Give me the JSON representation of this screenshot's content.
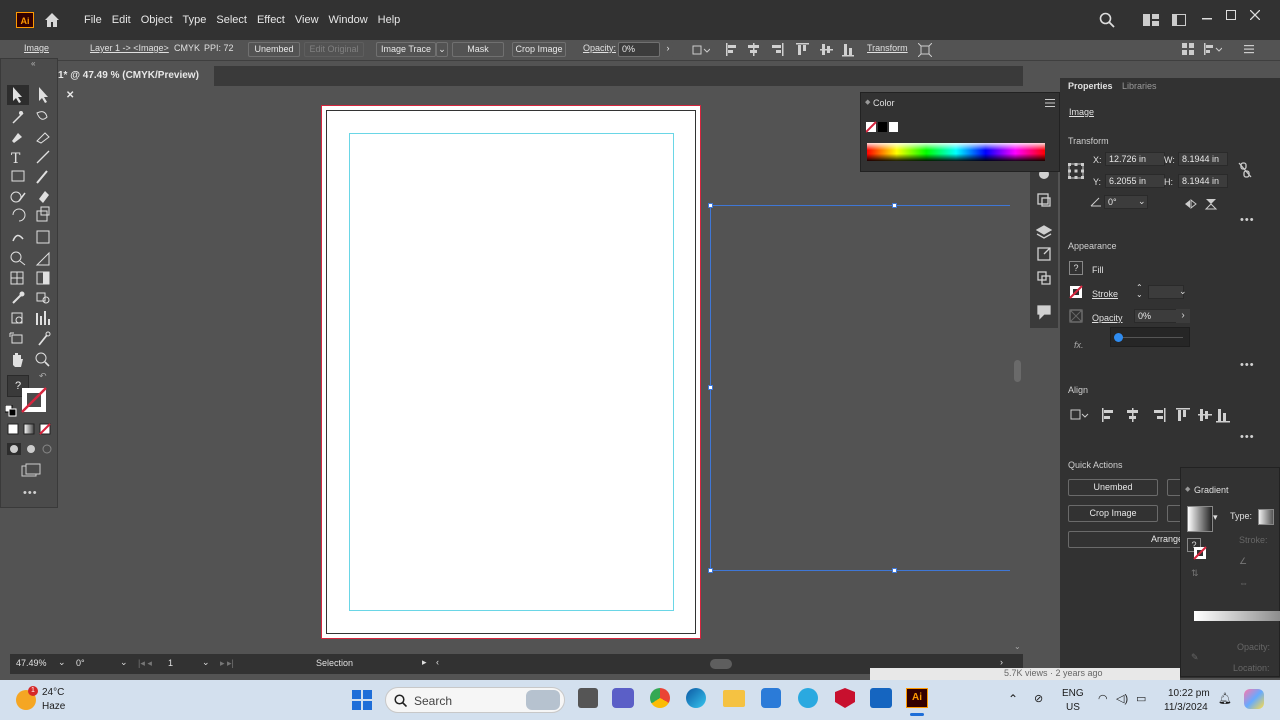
{
  "app": {
    "logo_text": "Ai"
  },
  "menu": [
    "File",
    "Edit",
    "Object",
    "Type",
    "Select",
    "Effect",
    "View",
    "Window",
    "Help"
  ],
  "control_bar": {
    "mode": "Image",
    "layer": "Layer 1 -> <Image>",
    "color_mode": "CMYK",
    "ppi": "PPI: 72",
    "embed_btn": "Unembed",
    "edit_original": "Edit Original",
    "image_trace": "Image Trace",
    "mask": "Mask",
    "crop_image": "Crop Image",
    "opacity_label": "Opacity:",
    "opacity_value": "0%",
    "transform": "Transform"
  },
  "document_tab": {
    "title": "1* @ 47.49 % (CMYK/Preview)",
    "close": "✕"
  },
  "status_bar": {
    "zoom": "47.49%",
    "rotation": "0°",
    "artboard": "1",
    "tool": "Selection"
  },
  "color_panel": {
    "title": "Color"
  },
  "properties": {
    "tabs": [
      "Properties",
      "Libraries"
    ],
    "object_type": "Image",
    "transform_title": "Transform",
    "x_label": "X:",
    "x_value": "12.726 in",
    "y_label": "Y:",
    "y_value": "6.2055 in",
    "w_label": "W:",
    "w_value": "8.1944 in",
    "h_label": "H:",
    "h_value": "8.1944 in",
    "angle_value": "0°",
    "appearance_title": "Appearance",
    "fill_label": "Fill",
    "stroke_label": "Stroke",
    "opacity_label": "Opacity",
    "opacity_value": "0%",
    "fx_label": "fx.",
    "align_title": "Align",
    "quick_actions_title": "Quick Actions",
    "qa_unembed": "Unembed",
    "qa_crop": "Crop Image",
    "qa_arrange": "Arrange"
  },
  "gradient_panel": {
    "title": "Gradient",
    "type_label": "Type:",
    "stroke_label": "Stroke:",
    "opacity_label": "Opacity:",
    "location_label": "Location:"
  },
  "taskbar": {
    "weather_temp": "24°C",
    "weather_desc": "Haze",
    "weather_badge": "1",
    "search_placeholder": "Search",
    "lang_top": "ENG",
    "lang_bottom": "US",
    "time": "10:22 pm",
    "date": "11/3/2024",
    "behind_text": "5.7K views · 2 years ago"
  }
}
